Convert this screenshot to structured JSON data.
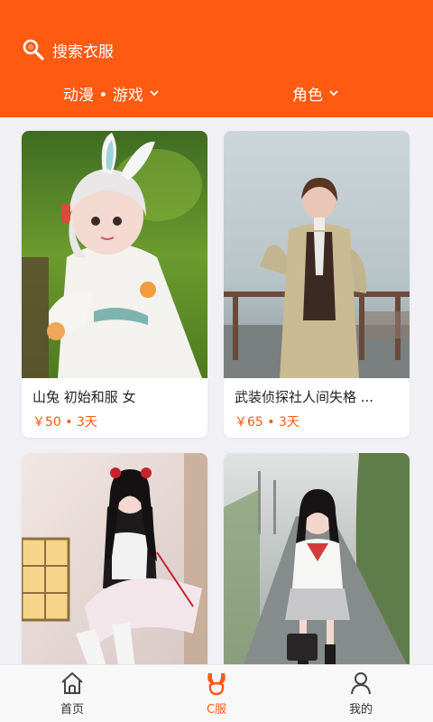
{
  "colors": {
    "accent": "#ff5a12",
    "background": "#f1f0f4"
  },
  "header": {
    "search_placeholder": "搜索衣服",
    "search_icon": "search-icon",
    "filters": [
      {
        "label": "动漫 • 游戏",
        "icon": "chevron-down-icon"
      },
      {
        "label": "角色",
        "icon": "chevron-down-icon"
      }
    ]
  },
  "items": [
    {
      "title": "山兔 初始和服 女",
      "price": "￥50 • 3天"
    },
    {
      "title": "武装侦探社人间失格 ...",
      "price": "￥65 • 3天"
    },
    {
      "title": "",
      "price": ""
    },
    {
      "title": "",
      "price": ""
    }
  ],
  "tabbar": {
    "tabs": [
      {
        "label": "首页",
        "icon": "home-icon"
      },
      {
        "label": "C服",
        "icon": "bunny-ears-icon"
      },
      {
        "label": "我的",
        "icon": "user-icon"
      }
    ],
    "active": "C服"
  }
}
